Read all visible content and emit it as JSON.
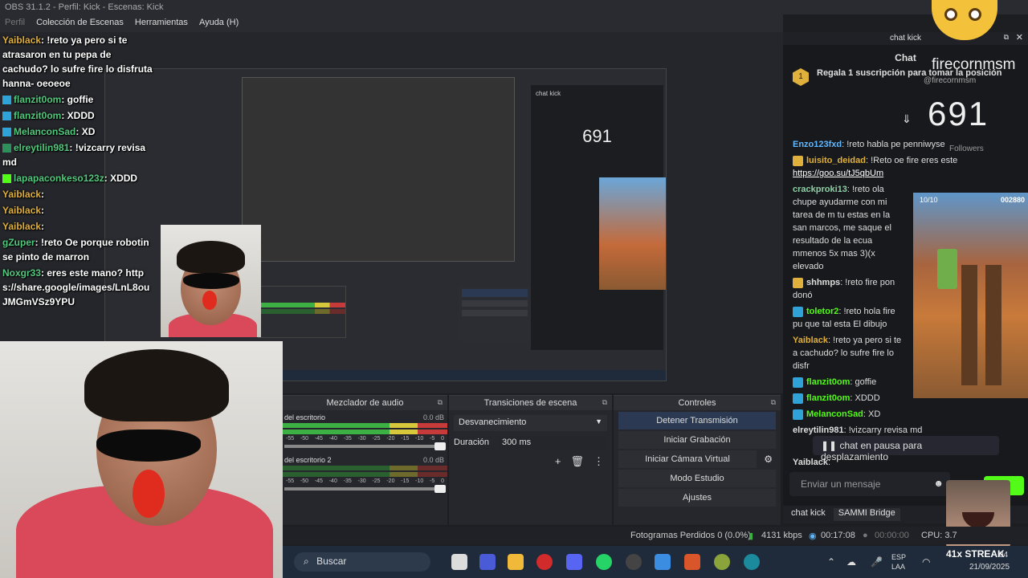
{
  "window": {
    "title": "OBS 31.1.2 - Perfil: Kick - Escenas: Kick"
  },
  "menu": [
    "Perfil",
    "Colección de Escenas",
    "Herramientas",
    "Ayuda (H)"
  ],
  "overlay_chat": [
    {
      "user": "Yaiblack",
      "text": ": !reto ya pero si te atrasaron en tu pepa de cachudo? lo sufre fire lo disfruta hanna- oeoeoe"
    },
    {
      "user": "flanzit0om",
      "text": ": goffie"
    },
    {
      "user": "flanzit0om",
      "text": ": XDDD"
    },
    {
      "user": "MelanconSad",
      "text": ": XD"
    },
    {
      "user": "elreytilin981",
      "text": ": !vizcarry revisa md"
    },
    {
      "user": "lapapaconkeso123z",
      "text": ": XDDD"
    },
    {
      "user": "Yaiblack",
      "text": ":"
    },
    {
      "user": "Yaiblack",
      "text": ":"
    },
    {
      "user": "Yaiblack",
      "text": ":"
    },
    {
      "user": "gZuper",
      "text": ": !reto Oe porque robotin se pinto de marron"
    },
    {
      "user": "Noxgr33",
      "text": ": eres este mano? https://share.google/images/LnL8ouJMGmVSz9YPU"
    }
  ],
  "audio_mixer": {
    "title": "Mezclador de audio",
    "tracks": [
      {
        "name": "del escritorio",
        "level": "0.0 dB"
      },
      {
        "name": "del escritorio 2",
        "level": "0.0 dB"
      }
    ],
    "scale": [
      "-55",
      "-50",
      "-45",
      "-40",
      "-35",
      "-30",
      "-25",
      "-20",
      "-15",
      "-10",
      "-5",
      "0"
    ]
  },
  "transitions": {
    "title": "Transiciones de escena",
    "selected": "Desvanecimiento",
    "duration_label": "Duración",
    "duration_value": "300 ms"
  },
  "controls": {
    "title": "Controles",
    "buttons": [
      "Detener Transmisión",
      "Iniciar Grabación",
      "Iniciar Cámara Virtual",
      "Modo Estudio",
      "Ajustes"
    ]
  },
  "chat_panel": {
    "title": "chat kick",
    "header": "Chat",
    "gift_text": "Regala 1 suscripción para tomar la posición",
    "gift_count": "1",
    "overlay_name": "firecornmsm",
    "overlay_handle": "@firecornmsm",
    "followers_count": "691",
    "followers_label": "Followers",
    "messages": [
      {
        "user": "Enzo123fxd",
        "text": ": !reto habla pe penniwyse",
        "color": "b"
      },
      {
        "user": "luisito_deidad",
        "text": ": !Reto oe fire eres este",
        "link": "https://goo.su/tJ5qbUm",
        "color": "y"
      },
      {
        "user": "crackproki13",
        "text": ": !reto ola chupe ayudarme con mi tarea de m tu estas en la san marcos, me saque el resultado de la ecua mmenos 5x mas 3)(x elevado",
        "color": "g"
      },
      {
        "user": "shhmps",
        "text": ": !reto fire pon donó",
        "color": "g"
      },
      {
        "user": "toletor2",
        "text": ": !reto hola fire pu que tal esta El dibujo",
        "color": "y"
      },
      {
        "user": "Yaiblack",
        "text": ": !reto ya pero si te a cachudo? lo sufre fire lo disfr",
        "color": "y"
      },
      {
        "user": "flanzit0om",
        "text": ": goffie",
        "color": "y"
      },
      {
        "user": "flanzit0om",
        "text": ": XDDD",
        "color": "y"
      },
      {
        "user": "MelanconSad",
        "text": ": XD",
        "color": "y"
      },
      {
        "user": "elreytilin981",
        "text": ": !vizcarry revisa md",
        "color": "g"
      },
      {
        "user": "Yaiblack",
        "text": ":",
        "color": "y"
      }
    ],
    "paused_text": "chat en pausa para desplazamiento",
    "input_placeholder": "Enviar un mensaje",
    "tabs": [
      "chat kick",
      "SAMMI Bridge"
    ],
    "game_score": "002880",
    "game_count": "10/10"
  },
  "status": {
    "frames": "Fotogramas Perdidos 0 (0.0%)",
    "bitrate": "4131 kbps",
    "stream_time": "00:17:08",
    "rec_time": "00:00:00",
    "cpu": "CPU: 3.7"
  },
  "taskbar": {
    "search": "Buscar",
    "lang": "ESP",
    "lang2": "LAA",
    "time": "04",
    "date": "21/09/2025",
    "streak": "41x STREAK"
  },
  "colors": {
    "accent": "#53fc18",
    "obs_bg": "#1d1e22",
    "shirt": "#d9495a"
  }
}
